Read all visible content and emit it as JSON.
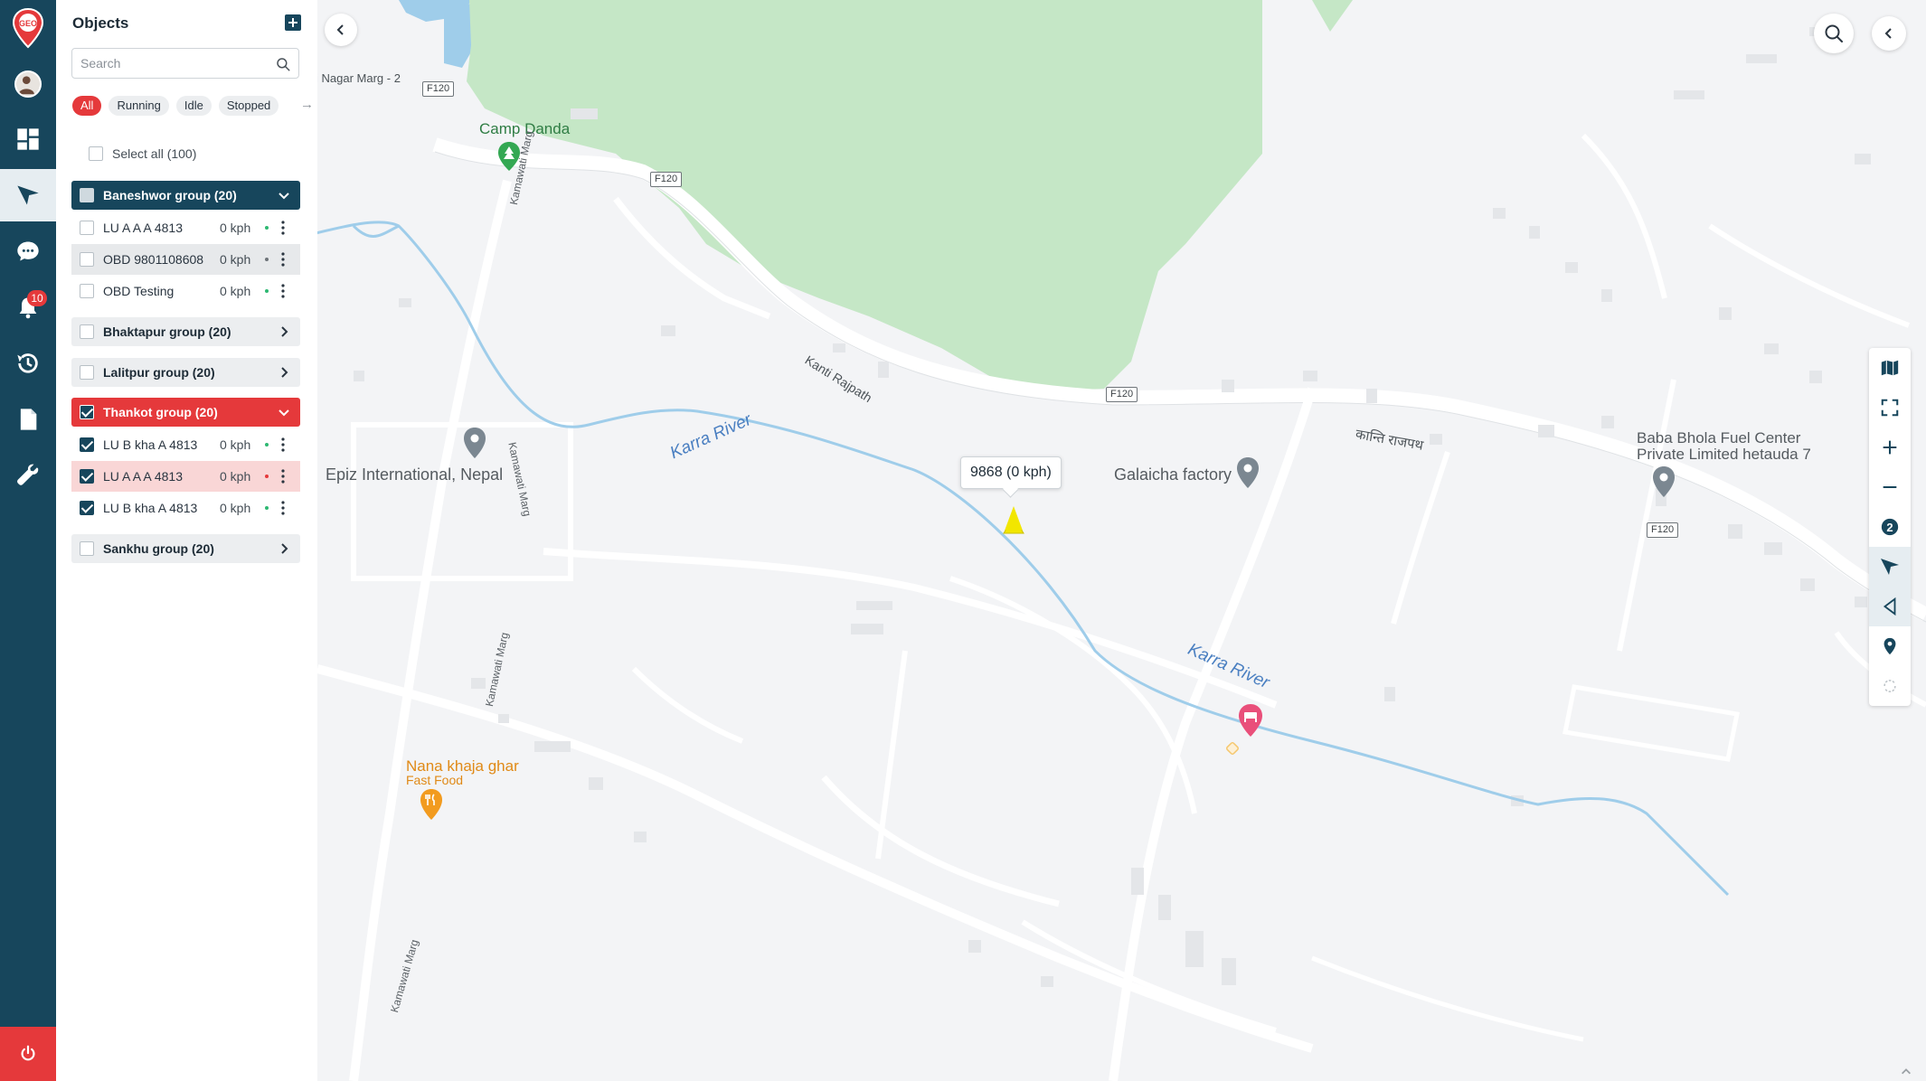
{
  "rail": {
    "notification_count": "10",
    "items": [
      {
        "name": "dashboard"
      },
      {
        "name": "tracking"
      },
      {
        "name": "messages"
      },
      {
        "name": "notifications"
      },
      {
        "name": "history"
      },
      {
        "name": "reports"
      },
      {
        "name": "settings"
      }
    ]
  },
  "panel": {
    "title": "Objects",
    "search_placeholder": "Search",
    "filters": [
      "All",
      "Running",
      "Idle",
      "Stopped"
    ],
    "select_all": "Select all (100)",
    "groups": [
      {
        "label": "Baneshwor group (20)",
        "style": "dark",
        "expanded": true,
        "items": [
          {
            "name": "LU A A A 4813",
            "speed": "0 kph",
            "status": "green"
          },
          {
            "name": "OBD 9801108608",
            "speed": "0 kph",
            "status": "grey"
          },
          {
            "name": "OBD Testing",
            "speed": "0 kph",
            "status": "green"
          }
        ]
      },
      {
        "label": "Bhaktapur group (20)",
        "style": "light",
        "expanded": false,
        "items": []
      },
      {
        "label": "Lalitpur group (20)",
        "style": "light",
        "expanded": false,
        "items": []
      },
      {
        "label": "Thankot group (20)",
        "style": "red",
        "expanded": true,
        "items": [
          {
            "name": "LU B kha A 4813",
            "speed": "0 kph",
            "status": "green"
          },
          {
            "name": "LU A A A 4813",
            "speed": "0 kph",
            "status": "red"
          },
          {
            "name": "LU B kha A 4813",
            "speed": "0 kph",
            "status": "green"
          }
        ]
      },
      {
        "label": "Sankhu group (20)",
        "style": "light",
        "expanded": false,
        "items": []
      }
    ]
  },
  "map": {
    "vehicle_tooltip": "9868 (0 kph)",
    "vehicle_color": "#f2e600",
    "tool_badge": "2",
    "labels": {
      "camp_danda": "Camp Danda",
      "nagar_marg": "i Nagar Marg - 2",
      "kanti_rajpath": "Kanti Rajpath",
      "kanti_rajpath_np": "कान्ति राजपथ",
      "karra_river_1": "Karra River",
      "karra_river_2": "Karra River",
      "epiz": "Epiz International, Nepal",
      "galaicha": "Galaicha factory",
      "baba_bhola_1": "Baba Bhola Fuel Center",
      "baba_bhola_2": "Private Limited hetauda 7",
      "nana_khaja": "Nana khaja ghar",
      "fast_food": "Fast Food",
      "kamawati_1": "Kamawati Marg",
      "kamawati_2": "Kamawati Marg",
      "kamawati_3": "Kamawati Marg",
      "kamawati_4": "Kamawati Marg"
    },
    "shields": {
      "s1": "F120",
      "s2": "F120",
      "s3": "F120",
      "s4": "F120"
    }
  },
  "colors": {
    "rail_bg": "#17465c",
    "accent_red": "#e5393b",
    "park_green": "#c5e7c6",
    "river_blue": "#9fcdea"
  }
}
